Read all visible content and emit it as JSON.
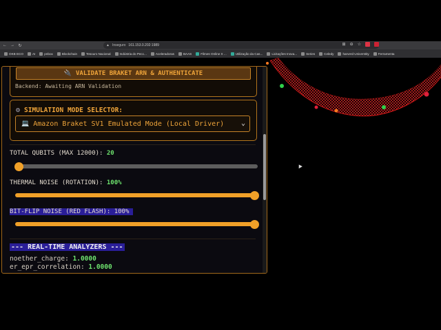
{
  "browser": {
    "url_security": "Inseguro",
    "url": "161.153.0.202:1989"
  },
  "bookmarks": [
    {
      "label": "OKB ECO"
    },
    {
      "label": "AI"
    },
    {
      "label": "pnbox"
    },
    {
      "label": "Blockchain"
    },
    {
      "label": "Tesouro Nacional"
    },
    {
      "label": "Indústria do Pecc..."
    },
    {
      "label": "Aceleradoras"
    },
    {
      "label": "BAAS"
    },
    {
      "label": "Filmes Online X ..."
    },
    {
      "label": "Utilização da Cas..."
    },
    {
      "label": "Licitações Inova..."
    },
    {
      "label": "Series"
    },
    {
      "label": "Celedy"
    },
    {
      "label": "harverd Universtity"
    },
    {
      "label": "Ferramenta"
    }
  ],
  "panel": {
    "validate_button": "VALIDATE BRAKET ARN & AUTHENTICATE",
    "backend_status": "Backend: Awaiting ARN Validation",
    "mode_title": "SIMULATION MODE SELECTOR:",
    "mode_selected": "Amazon Braket SV1 Emulated Mode (Local Driver)",
    "qubits_label": "TOTAL QUBITS (MAX 12000): ",
    "qubits_value": "20",
    "qubits_fraction": 0.0017,
    "thermal_label": "THERMAL NOISE (ROTATION): ",
    "thermal_value": "100%",
    "thermal_fraction": 1.0,
    "bitflip_label": "BIT-FLIP NOISE (RED FLASH): ",
    "bitflip_value": "100%",
    "bitflip_fraction": 1.0,
    "analyzers_title": "--- REAL-TIME ANALYZERS ---",
    "metrics": [
      {
        "name": "noether_charge: ",
        "value": "1.0000"
      },
      {
        "name": "er_epr_correlation: ",
        "value": "1.0000"
      }
    ]
  },
  "colors": {
    "accent": "#f0a028",
    "value_green": "#6ee36e",
    "highlight": "#2a1e98",
    "torus_red": "#d01818"
  }
}
